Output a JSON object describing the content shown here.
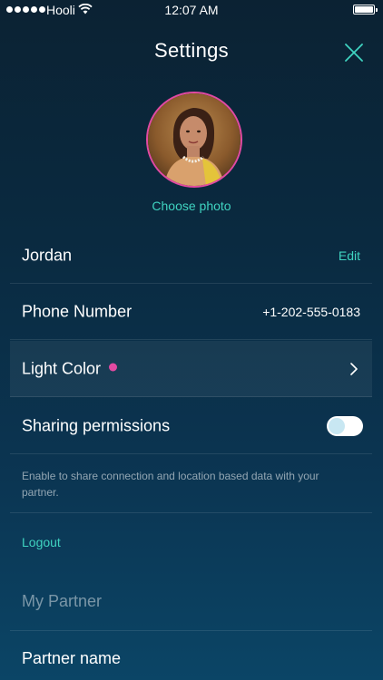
{
  "status_bar": {
    "carrier": "Hooli",
    "time": "12:07 AM"
  },
  "header": {
    "title": "Settings",
    "close_icon": "close-icon"
  },
  "profile": {
    "choose_photo_label": "Choose photo",
    "avatar_border_color": "#e24aa2"
  },
  "rows": {
    "name": {
      "value": "Jordan",
      "action": "Edit"
    },
    "phone": {
      "label": "Phone Number",
      "value": "+1-202-555-0183"
    },
    "light_color": {
      "label": "Light Color",
      "color": "#e24aa2",
      "icon": "chevron-right-icon"
    },
    "sharing": {
      "label": "Sharing permissions",
      "enabled": false
    }
  },
  "sharing_help": "Enable to share connection and location based data with your partner.",
  "logout_label": "Logout",
  "partner": {
    "section_title": "My Partner",
    "name_label": "Partner name"
  },
  "colors": {
    "accent": "#3fd3c0",
    "highlight": "#e24aa2",
    "background_top": "#0b2233",
    "background_bottom": "#0b4566"
  }
}
